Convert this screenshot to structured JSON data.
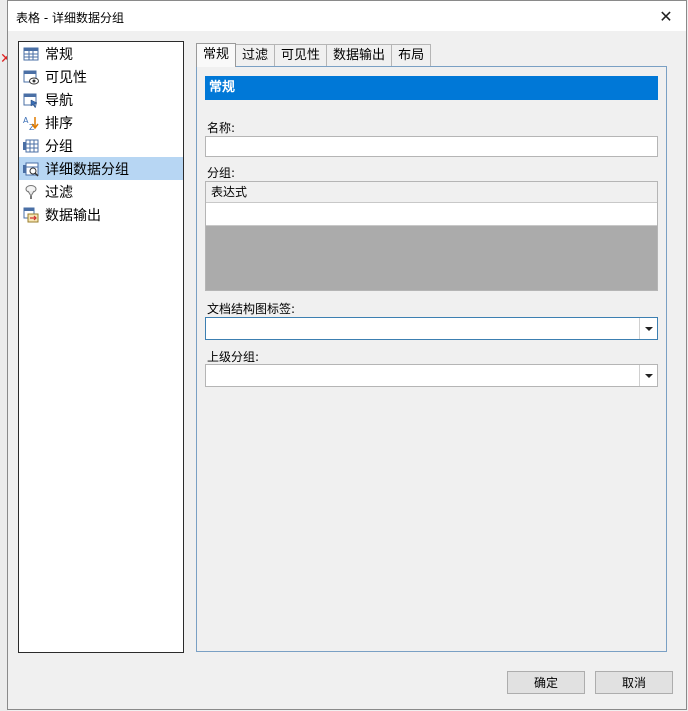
{
  "window": {
    "title": "表格 - 详细数据分组"
  },
  "nav": {
    "items": [
      {
        "label": "常规",
        "icon": "table-icon"
      },
      {
        "label": "可见性",
        "icon": "visibility-icon"
      },
      {
        "label": "导航",
        "icon": "navigation-icon"
      },
      {
        "label": "排序",
        "icon": "sort-icon"
      },
      {
        "label": "分组",
        "icon": "group-icon"
      },
      {
        "label": "详细数据分组",
        "icon": "detail-group-icon",
        "selected": true
      },
      {
        "label": "过滤",
        "icon": "filter-icon"
      },
      {
        "label": "数据输出",
        "icon": "data-output-icon"
      }
    ]
  },
  "tabs": [
    "常规",
    "过滤",
    "可见性",
    "数据输出",
    "布局"
  ],
  "panel": {
    "section_title": "常规",
    "name_label": "名称:",
    "name_value": "",
    "group_label": "分组:",
    "group_column": "表达式",
    "doc_map_label": "文档结构图标签:",
    "doc_map_value": "",
    "parent_group_label": "上级分组:",
    "parent_group_value": ""
  },
  "buttons": {
    "ok": "确定",
    "cancel": "取消"
  },
  "colors": {
    "accent": "#0078d7",
    "selection": "#b7d6f3"
  }
}
